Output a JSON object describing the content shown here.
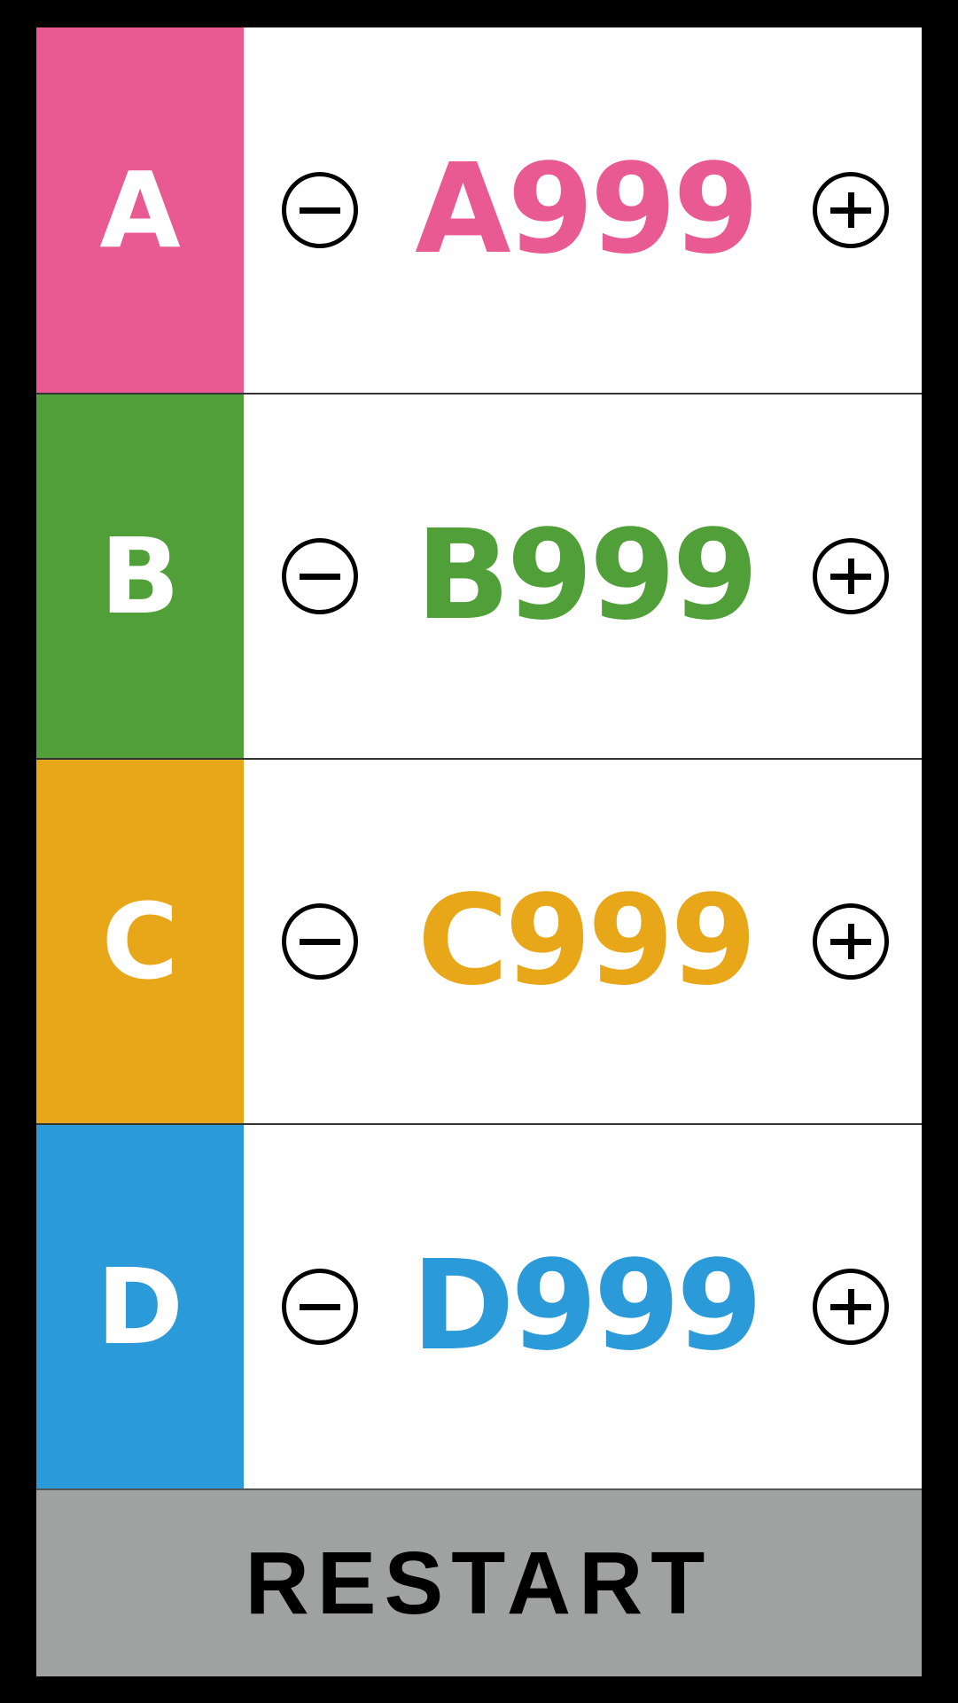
{
  "counters": [
    {
      "label": "A",
      "value": "A999",
      "color": "#e95a93",
      "minus_icon": "circle-minus-icon",
      "plus_icon": "circle-plus-icon"
    },
    {
      "label": "B",
      "value": "B999",
      "color": "#519f39",
      "minus_icon": "circle-minus-icon",
      "plus_icon": "circle-plus-icon"
    },
    {
      "label": "C",
      "value": "C999",
      "color": "#e8a619",
      "minus_icon": "circle-minus-icon",
      "plus_icon": "circle-plus-icon"
    },
    {
      "label": "D",
      "value": "D999",
      "color": "#2b9ad8",
      "minus_icon": "circle-minus-icon",
      "plus_icon": "circle-plus-icon"
    }
  ],
  "restart_label": "RESTART",
  "colors": {
    "frame": "#000000",
    "restart_bg": "#a0a2a1",
    "background": "#ffffff"
  }
}
